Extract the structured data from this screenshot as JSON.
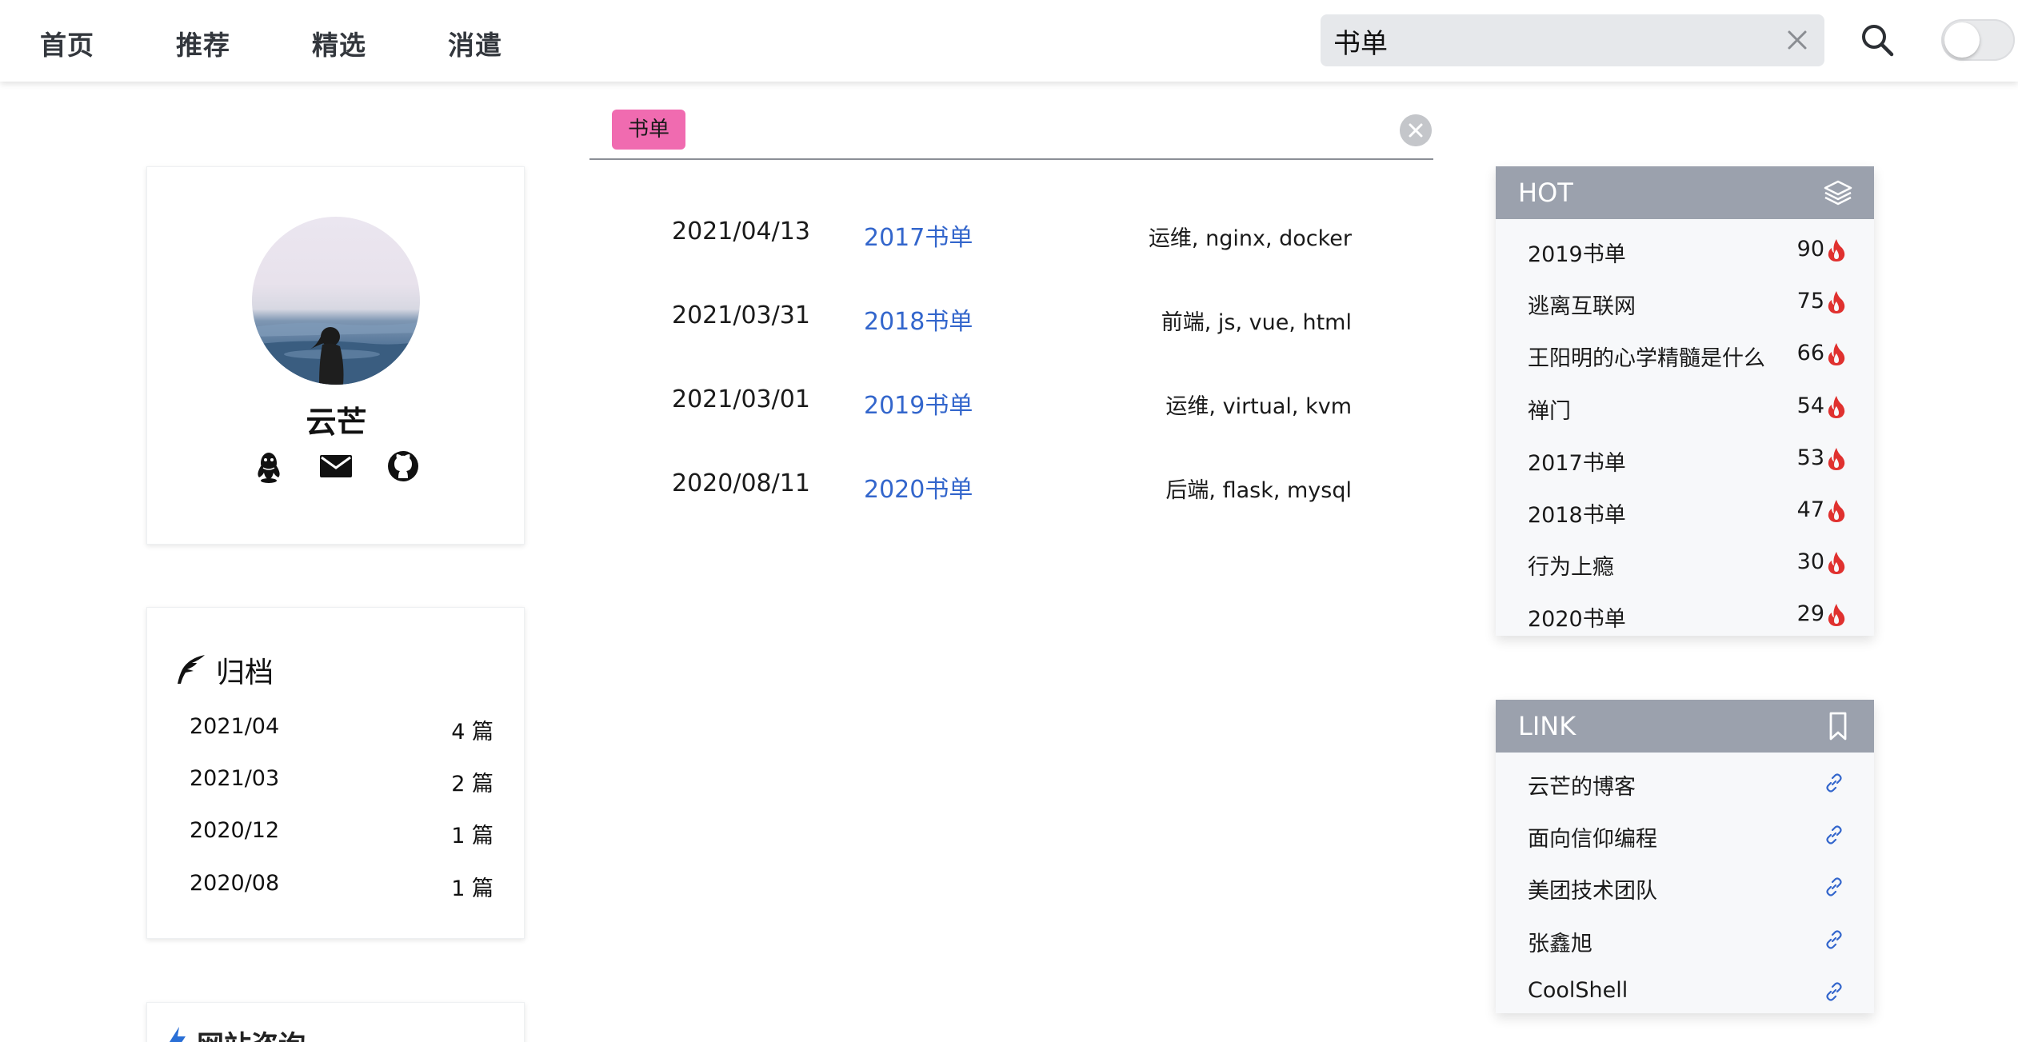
{
  "nav": {
    "links": [
      "首页",
      "推荐",
      "精选",
      "消遣"
    ],
    "search_value": "书单",
    "icons": {
      "clear": "close-icon",
      "search": "search-icon",
      "toggle": "theme-toggle"
    }
  },
  "profile": {
    "name": "云芒",
    "social_icons": [
      "qq-icon",
      "mail-icon",
      "github-icon"
    ]
  },
  "archive": {
    "title": "归档",
    "items": [
      {
        "month": "2021/04",
        "count": "4 篇"
      },
      {
        "month": "2021/03",
        "count": "2 篇"
      },
      {
        "month": "2020/12",
        "count": "1 篇"
      },
      {
        "month": "2020/08",
        "count": "1 篇"
      }
    ]
  },
  "site_info": {
    "title": "网站咨询"
  },
  "filter": {
    "tag": "书单"
  },
  "results": [
    {
      "date": "2021/04/13",
      "title": "2017书单",
      "tags": "运维, nginx, docker"
    },
    {
      "date": "2021/03/31",
      "title": "2018书单",
      "tags": "前端, js, vue, html"
    },
    {
      "date": "2021/03/01",
      "title": "2019书单",
      "tags": "运维, virtual, kvm"
    },
    {
      "date": "2020/08/11",
      "title": "2020书单",
      "tags": "后端, flask, mysql"
    }
  ],
  "hot": {
    "title": "HOT",
    "items": [
      {
        "label": "2019书单",
        "count": "90"
      },
      {
        "label": "逃离互联网",
        "count": "75"
      },
      {
        "label": "王阳明的心学精髓是什么",
        "count": "66"
      },
      {
        "label": "禅门",
        "count": "54"
      },
      {
        "label": "2017书单",
        "count": "53"
      },
      {
        "label": "2018书单",
        "count": "47"
      },
      {
        "label": "行为上瘾",
        "count": "30"
      },
      {
        "label": "2020书单",
        "count": "29"
      }
    ]
  },
  "links": {
    "title": "LINK",
    "items": [
      {
        "label": "云芒的博客"
      },
      {
        "label": "面向信仰编程"
      },
      {
        "label": "美团技术团队"
      },
      {
        "label": "张鑫旭"
      },
      {
        "label": "CoolShell"
      }
    ]
  },
  "colors": {
    "accent_link": "#3366cc",
    "tag_chip": "#f06bb0",
    "panel_header": "#9ba1ad",
    "fire": "#e0312f"
  }
}
